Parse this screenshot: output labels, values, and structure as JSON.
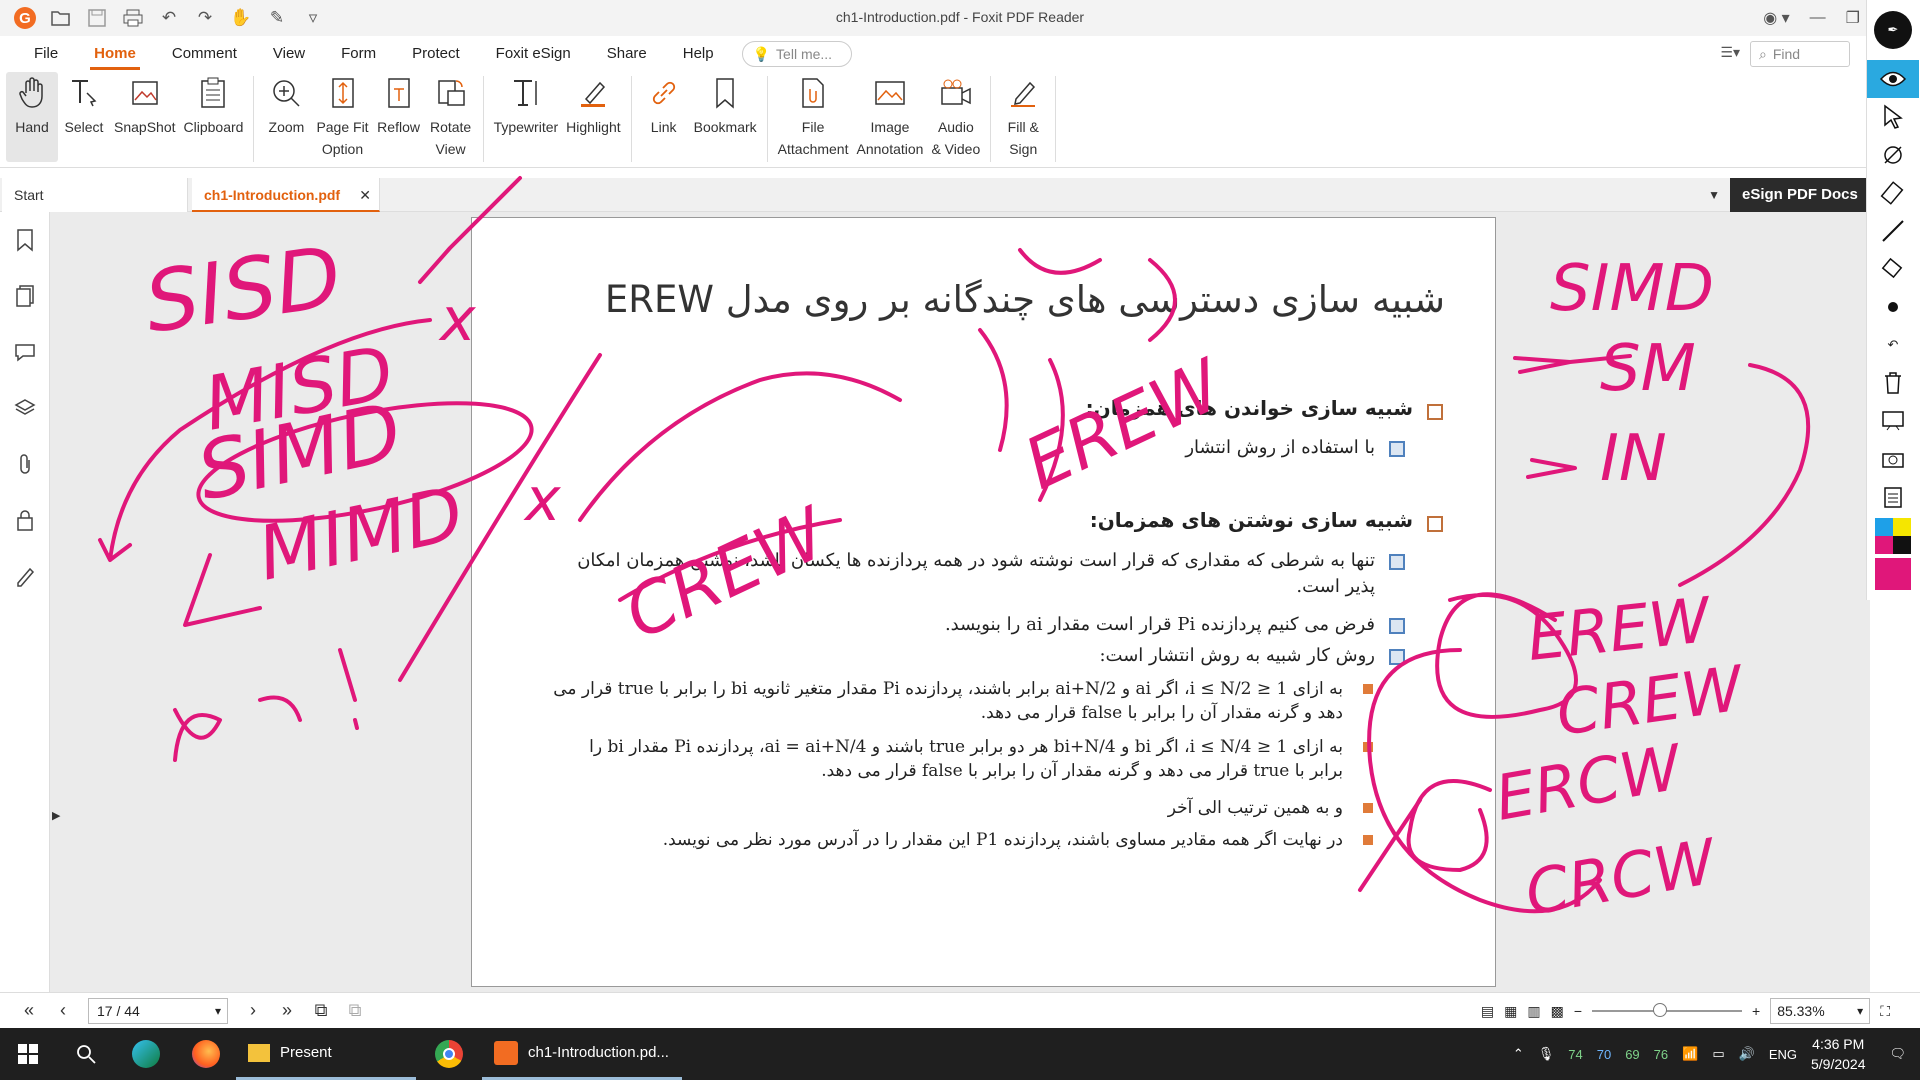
{
  "window": {
    "title": "ch1-Introduction.pdf - Foxit PDF Reader"
  },
  "menu": {
    "items": [
      "File",
      "Home",
      "Comment",
      "View",
      "Form",
      "Protect",
      "Foxit eSign",
      "Share",
      "Help"
    ],
    "active": "Home",
    "tell_me_placeholder": "Tell me...",
    "find_placeholder": "Find"
  },
  "ribbon": {
    "hand": "Hand",
    "select": "Select",
    "snapshot": "SnapShot",
    "clipboard": "Clipboard",
    "zoom": "Zoom",
    "page_fit": "Page Fit\nOption",
    "reflow": "Reflow",
    "rotate": "Rotate\nView",
    "typewriter": "Typewriter",
    "highlight": "Highlight",
    "link": "Link",
    "bookmark": "Bookmark",
    "file_attachment": "File\nAttachment",
    "image_annotation": "Image\nAnnotation",
    "audio_video": "Audio\n& Video",
    "fill_sign": "Fill &\nSign"
  },
  "tabs": {
    "start": "Start",
    "doc": "ch1-Introduction.pdf",
    "close": "✕",
    "esign": "eSign PDF Docs"
  },
  "slide": {
    "title": "شبیه سازی دسترسی های چندگانه بر روی مدل EREW",
    "h1": "شبیه سازی خواندن های همزمان:",
    "h1_sub": "با استفاده از روش انتشار",
    "h2": "شبیه سازی نوشتن های همزمان:",
    "b1": "تنها به شرطی که مقداری که قرار است نوشته شود در همه پردازنده ها یکسان باشد، نوشتن همزمان امکان پذیر است.",
    "b2": "فرض می کنیم پردازنده Pi قرار است مقدار ai را بنویسد.",
    "b3": "روش کار شبیه به روش انتشار است:",
    "s1": "به ازای 1 ≤ i ≤ N/2، اگر ai و ai+N/2 برابر باشند، پردازنده Pi مقدار متغیر ثانویه bi را برابر با true قرار می دهد و گرنه مقدار آن را برابر با false قرار می دهد.",
    "s2": "به ازای 1 ≤ i ≤ N/4، اگر bi و bi+N/4 هر دو برابر true باشند و ai = ai+N/4، پردازنده Pi مقدار bi را برابر با true قرار می دهد و گرنه مقدار آن را برابر با false قرار می دهد.",
    "s3": "و به همین ترتیب الی آخر",
    "s4": "در نهایت اگر همه مقادیر مساوی باشند، پردازنده P1 این مقدار را در آدرس مورد نظر می نویسد."
  },
  "ink": {
    "color": "#e0177a",
    "left": [
      "SISD",
      "MISD",
      "SIMD",
      "MIMD"
    ],
    "right": [
      "SIMD",
      "SM",
      "IN",
      "EREW",
      "CREW",
      "ERCW",
      "CRCW"
    ],
    "middle": [
      "CREW",
      "EREW"
    ]
  },
  "status": {
    "page": "17 / 44",
    "zoom": "85.33%",
    "zoom_fraction": 0.45
  },
  "taskbar": {
    "present": "Present",
    "foxit": "ch1-Introduction.pd...",
    "nums": [
      "74",
      "70",
      "69",
      "76"
    ],
    "lang": "ENG",
    "time": "4:36 PM",
    "date": "5/9/2024"
  }
}
